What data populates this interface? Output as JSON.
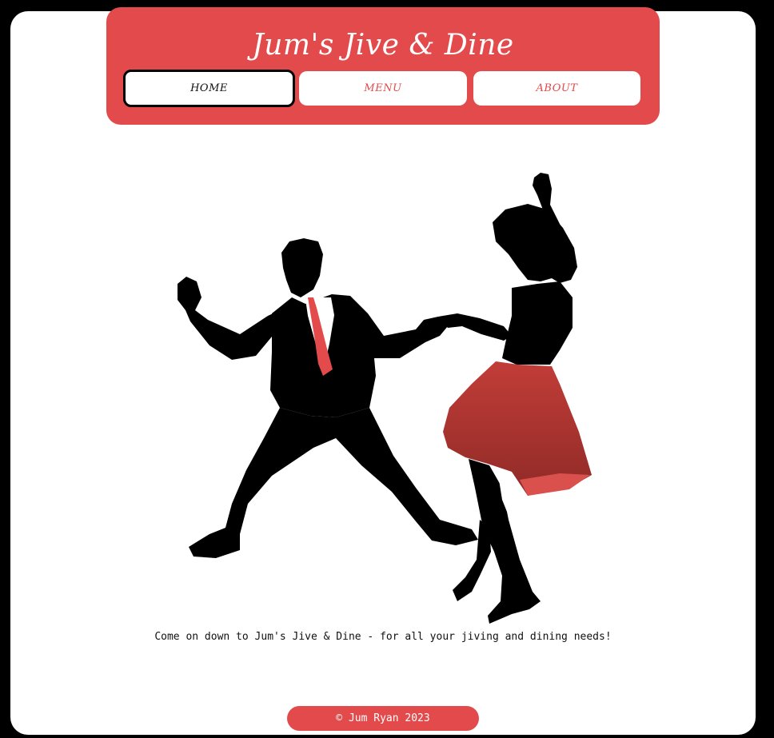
{
  "header": {
    "site_title": "Jum's Jive & Dine",
    "nav": [
      {
        "label": "HOME",
        "active": true
      },
      {
        "label": "MENU",
        "active": false
      },
      {
        "label": "ABOUT",
        "active": false
      }
    ]
  },
  "main": {
    "hero_image": "swing-dancers-silhouette",
    "tagline": "Come on down to Jum's Jive & Dine - for all your jiving and dining needs!"
  },
  "footer": {
    "copyright": "© Jum Ryan 2023"
  },
  "colors": {
    "accent": "#e34a4c",
    "skirt": "#a83430",
    "silhouette": "#000000",
    "background": "#000000",
    "card": "#ffffff"
  }
}
